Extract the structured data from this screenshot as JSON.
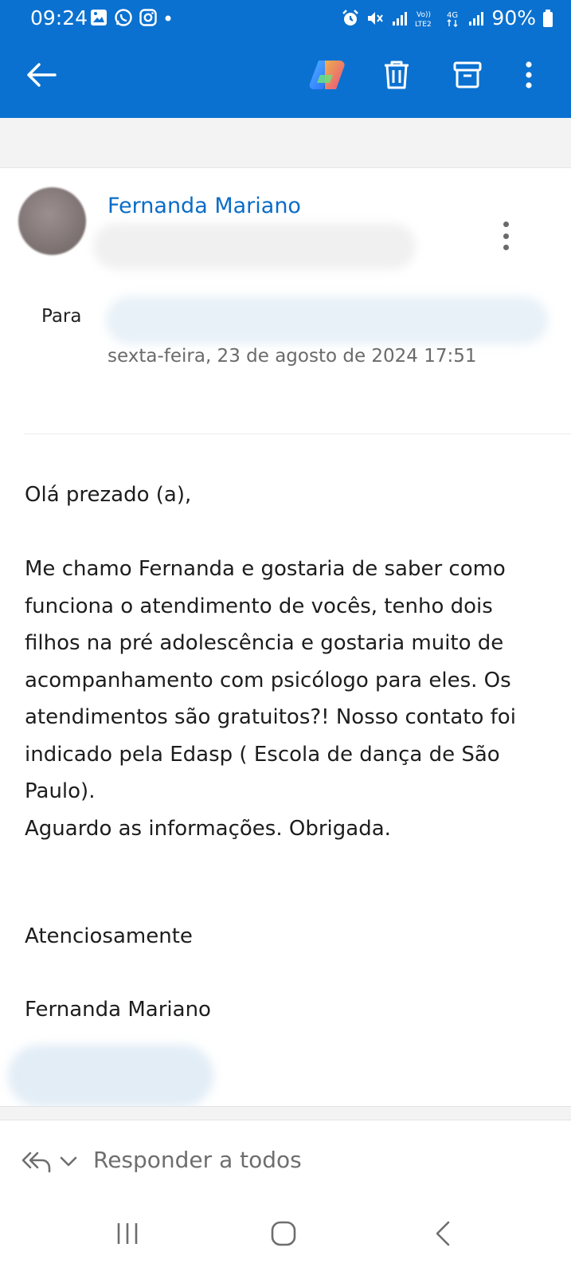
{
  "status_bar": {
    "time": "09:24",
    "battery": "90%",
    "network": "4G"
  },
  "toolbar": {
    "back_icon": "arrow-left-icon",
    "copilot_icon": "copilot-icon",
    "delete_icon": "trash-icon",
    "archive_icon": "archive-icon",
    "more_icon": "more-vertical-icon"
  },
  "message": {
    "sender_name": "Fernanda Mariano",
    "to_label": "Para",
    "date": "sexta-feira, 23 de agosto de 2024 17:51",
    "body": {
      "greeting": "Olá prezado (a),",
      "paragraph": "Me chamo Fernanda e gostaria de saber como\nfunciona o atendimento de vocês, tenho dois\nfilhos na pré adolescência e gostaria muito de\nacompanhamento com psicólogo para eles. Os\natendimentos são gratuitos?! Nosso contato foi\nindicado pela Edasp ( Escola de dança de São\nPaulo).\nAguardo as informações. Obrigada.",
      "closing": "Atenciosamente",
      "signature": "Fernanda Mariano"
    }
  },
  "reply_bar": {
    "label": "Responder a todos"
  },
  "colors": {
    "accent": "#0a71d0",
    "sender": "#0a6cc7"
  }
}
